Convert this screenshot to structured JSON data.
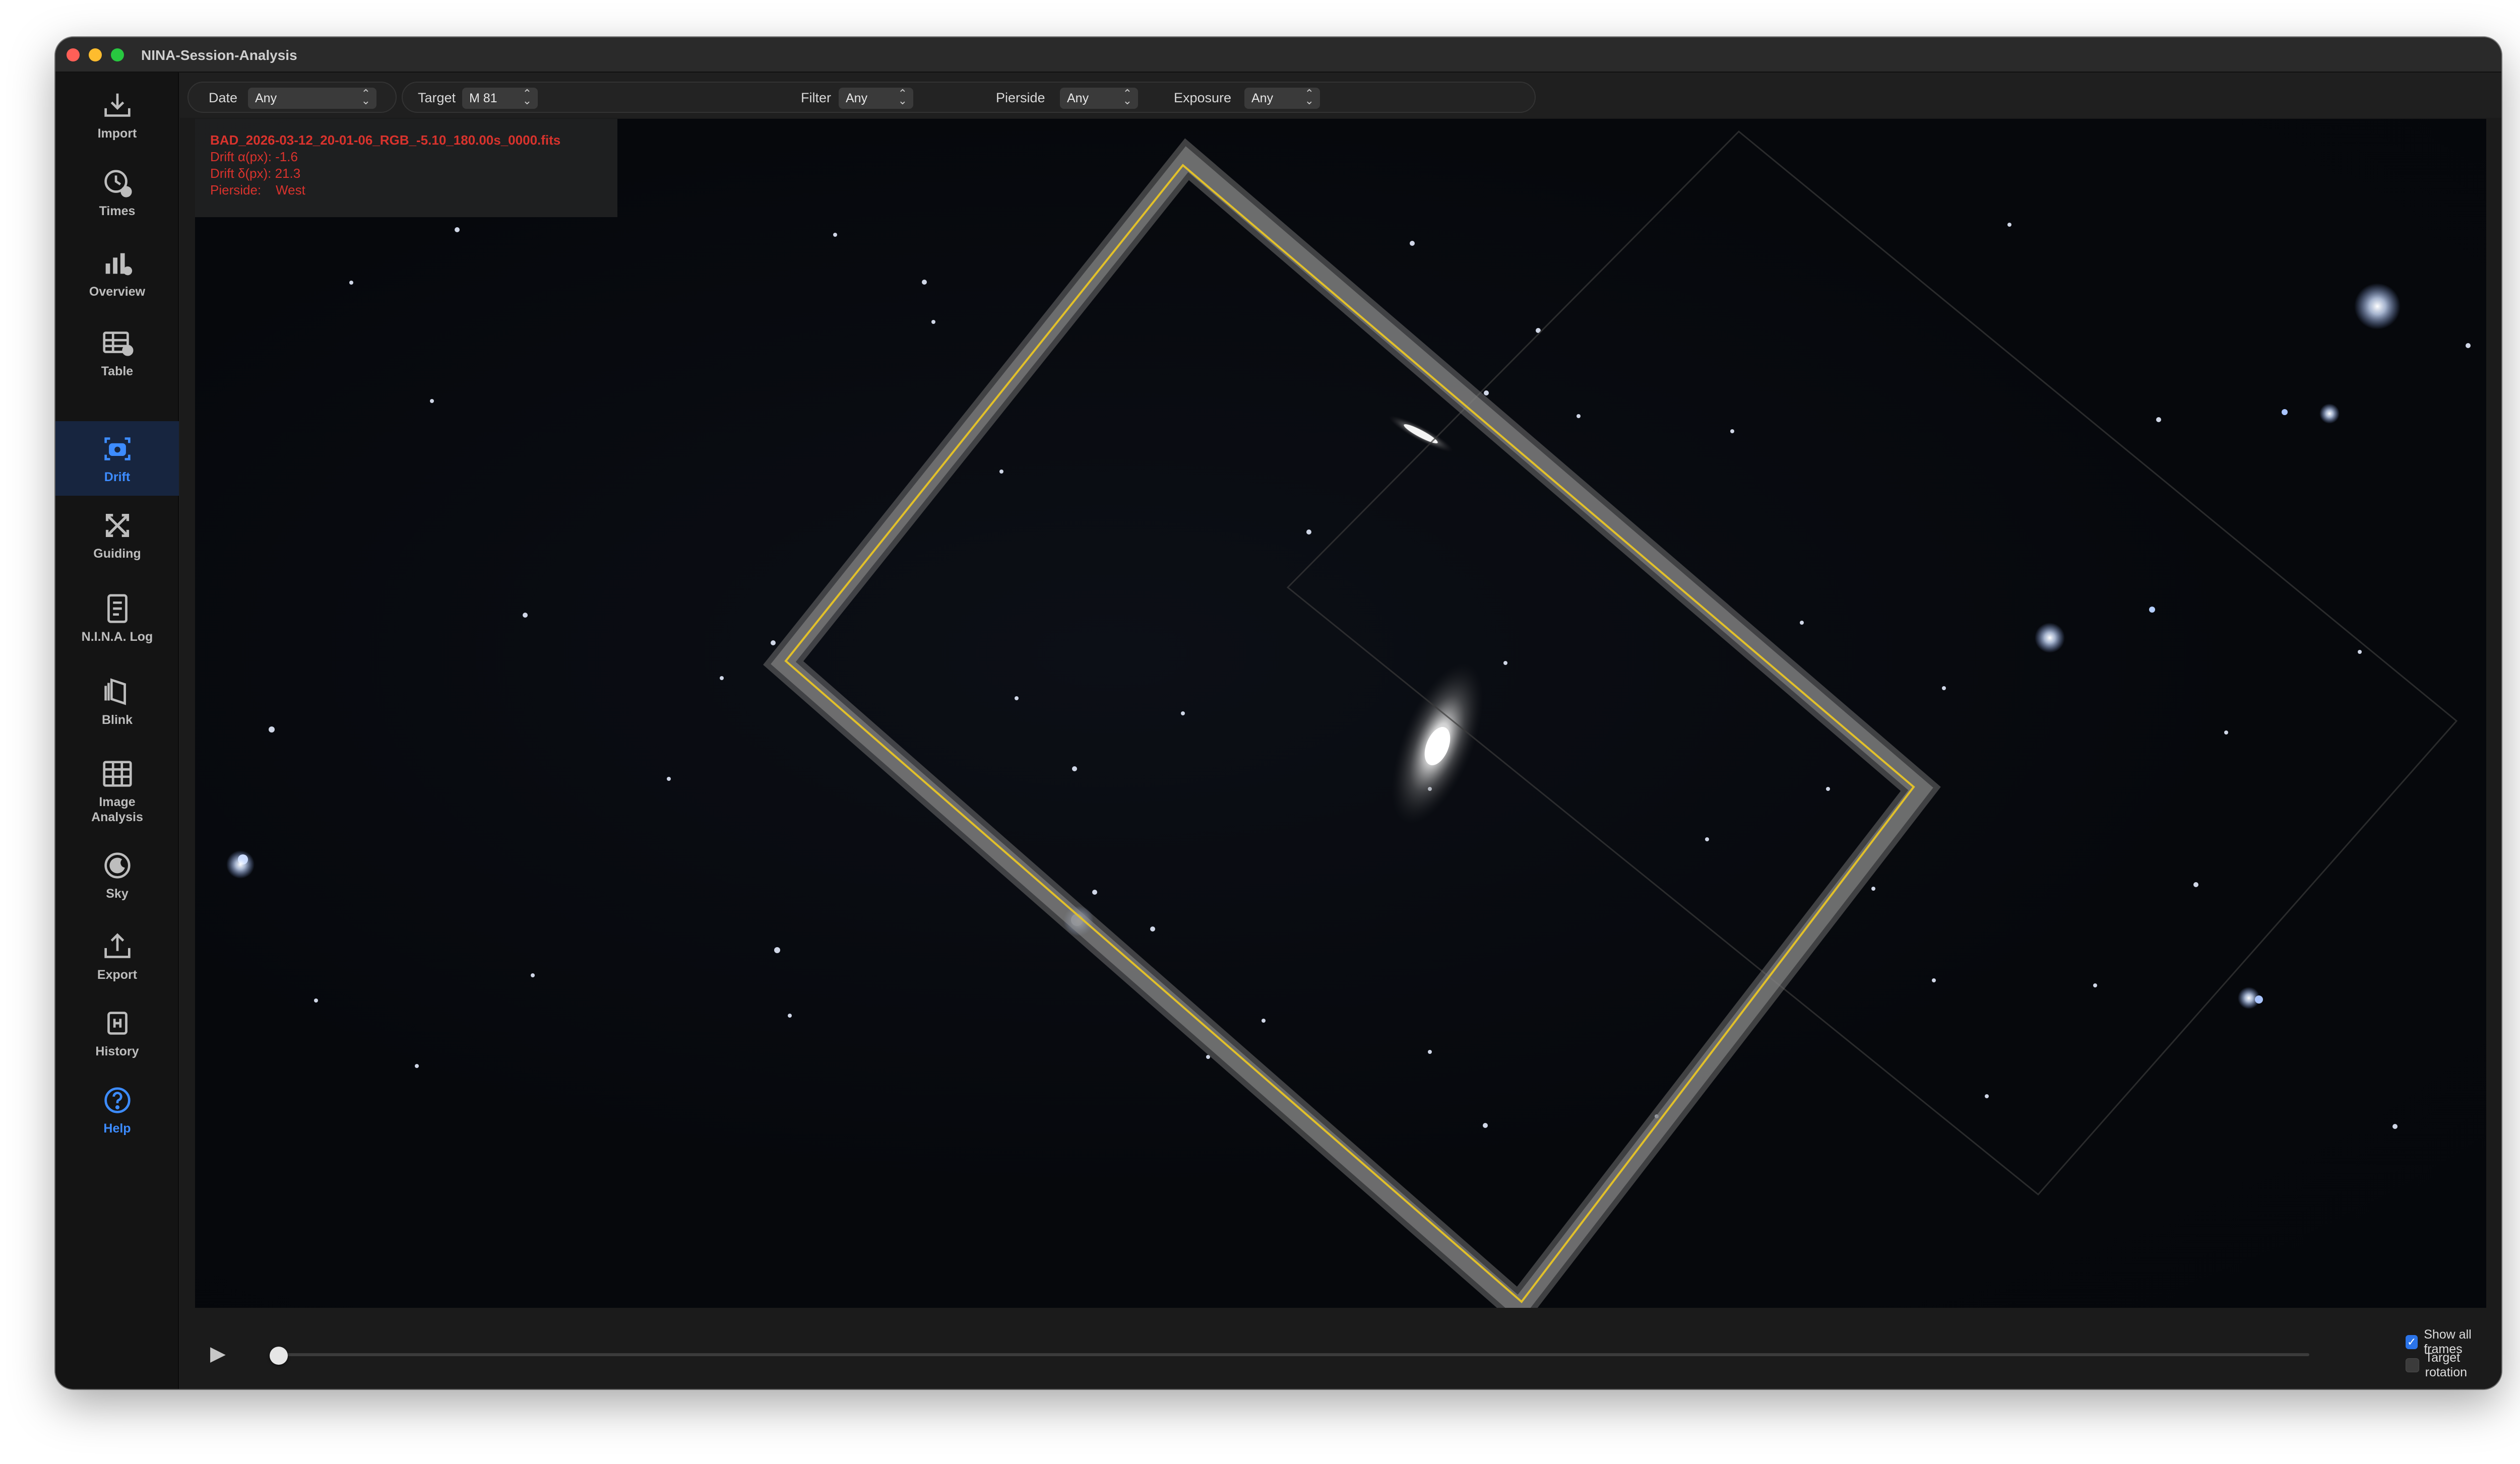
{
  "window": {
    "title": "NINA-Session-Analysis"
  },
  "sidebar": {
    "items": [
      {
        "label": "Import",
        "icon": "import-icon"
      },
      {
        "label": "Times",
        "icon": "clock-icon"
      },
      {
        "label": "Overview",
        "icon": "bar-chart-icon"
      },
      {
        "label": "Table",
        "icon": "table-icon"
      },
      {
        "label": "Drift",
        "icon": "camera-icon",
        "active": true
      },
      {
        "label": "Guiding",
        "icon": "arrows-expand-icon"
      },
      {
        "label": "N.I.N.A. Log",
        "icon": "document-icon"
      },
      {
        "label": "Blink",
        "icon": "layers-icon"
      },
      {
        "label": "Image\nAnalysis",
        "icon": "grid-icon"
      },
      {
        "label": "Sky",
        "icon": "moon-icon"
      },
      {
        "label": "Export",
        "icon": "export-icon"
      },
      {
        "label": "History",
        "icon": "history-icon"
      },
      {
        "label": "Help",
        "icon": "help-icon"
      }
    ]
  },
  "filters": {
    "date": {
      "label": "Date",
      "value": "Any"
    },
    "target": {
      "label": "Target",
      "value": "M 81"
    },
    "filter": {
      "label": "Filter",
      "value": "Any"
    },
    "pierside": {
      "label": "Pierside",
      "value": "Any"
    },
    "exposure": {
      "label": "Exposure",
      "value": "Any"
    }
  },
  "frame_info": {
    "filename": "BAD_2026-03-12_20-01-06_RGB_-5.10_180.00s_0000.fits",
    "drift_alpha": "Drift α(px): -1.6",
    "drift_delta": "Drift δ(px): 21.3",
    "pierside": "Pierside:    West"
  },
  "playback": {
    "position_fraction": 0.0,
    "show_all_frames": {
      "label": "Show all frames",
      "checked": true
    },
    "target_rotation": {
      "label": "Target rotation",
      "checked": false
    }
  },
  "colors": {
    "accent": "#3d8cff",
    "frame_outline": "#e1c02a",
    "info_text": "#d9332d"
  }
}
